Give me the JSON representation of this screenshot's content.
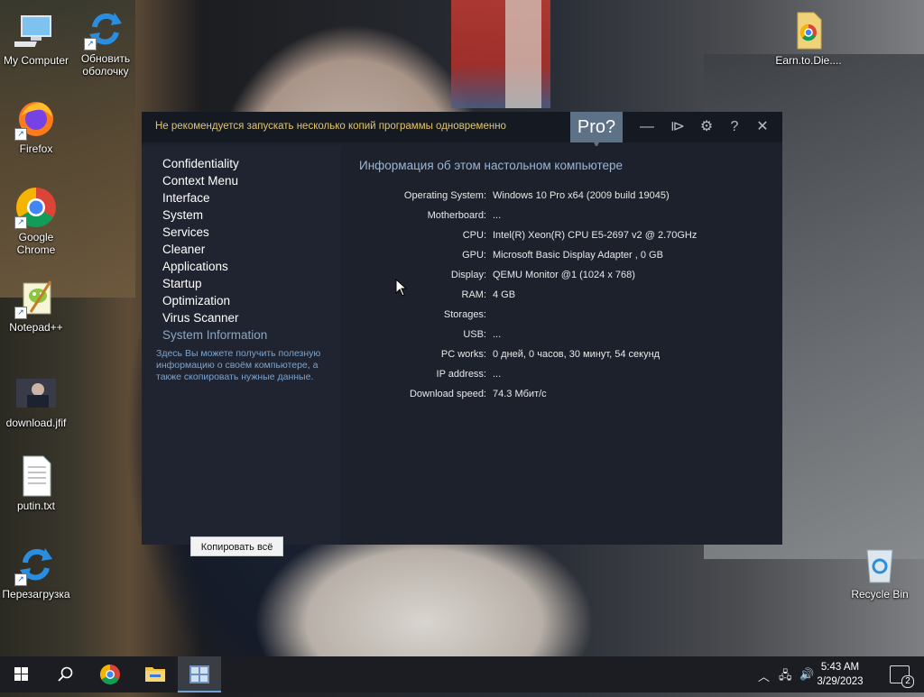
{
  "desktop": {
    "icons": [
      {
        "label": "My Computer",
        "icon": "computer-icon"
      },
      {
        "label": "Обновить оболочку",
        "icon": "refresh-icon"
      },
      {
        "label": "Earn.to.Die....",
        "icon": "chrome-file-icon"
      },
      {
        "label": "Firefox",
        "icon": "firefox-icon"
      },
      {
        "label": "Google Chrome",
        "icon": "chrome-icon"
      },
      {
        "label": "Notepad++",
        "icon": "notepadpp-icon"
      },
      {
        "label": "download.jfif",
        "icon": "image-file-icon"
      },
      {
        "label": "putin.txt",
        "icon": "text-file-icon"
      },
      {
        "label": "Перезагрузка",
        "icon": "refresh-icon"
      },
      {
        "label": "Recycle Bin",
        "icon": "recycle-bin-icon"
      }
    ]
  },
  "app": {
    "warning": "Не рекомендуется запускать несколько копий программы одновременно",
    "pro_label": "Pro?",
    "title_buttons": {
      "minimize": "—",
      "pin": "⧐",
      "settings": "⚙",
      "help": "?",
      "close": "✕"
    },
    "menu": [
      "Confidentiality",
      "Context Menu",
      "Interface",
      "System",
      "Services",
      "Cleaner",
      "Applications",
      "Startup",
      "Optimization",
      "Virus Scanner",
      "System Information"
    ],
    "active_menu": "System Information",
    "side_note": "Здесь Вы можете получить полезную информацию о своём компьютере, а также скопировать нужные данные.",
    "copy_button": "Копировать всё",
    "content_title": "Информация об этом настольном компьютере",
    "info": [
      {
        "key": "Operating System:",
        "value": "Windows 10 Pro x64 (2009 build 19045)"
      },
      {
        "key": "Motherboard:",
        "value": "..."
      },
      {
        "key": "CPU:",
        "value": "Intel(R) Xeon(R) CPU E5-2697 v2 @ 2.70GHz"
      },
      {
        "key": "GPU:",
        "value": "Microsoft Basic Display Adapter , 0 GB"
      },
      {
        "key": "Display:",
        "value": "QEMU Monitor @1 (1024 x 768)"
      },
      {
        "key": "RAM:",
        "value": "4 GB"
      },
      {
        "key": "Storages:",
        "value": ""
      },
      {
        "key": "USB:",
        "value": "..."
      },
      {
        "key": "PC works:",
        "value": "0 дней, 0 часов, 30 минут, 54 секунд"
      },
      {
        "key": "IP address:",
        "value": "..."
      },
      {
        "key": "Download speed:",
        "value": "74.3 Мбит/с"
      }
    ],
    "colors": {
      "accent": "#89a7c6",
      "warning": "#e2c46e",
      "pro": "#5d7187"
    }
  },
  "taskbar": {
    "time": "5:43 AM",
    "date": "3/29/2023",
    "notification_count": "2",
    "apps": [
      "start-icon",
      "search-icon",
      "chrome-icon",
      "file-explorer-icon",
      "app-window-icon"
    ]
  }
}
